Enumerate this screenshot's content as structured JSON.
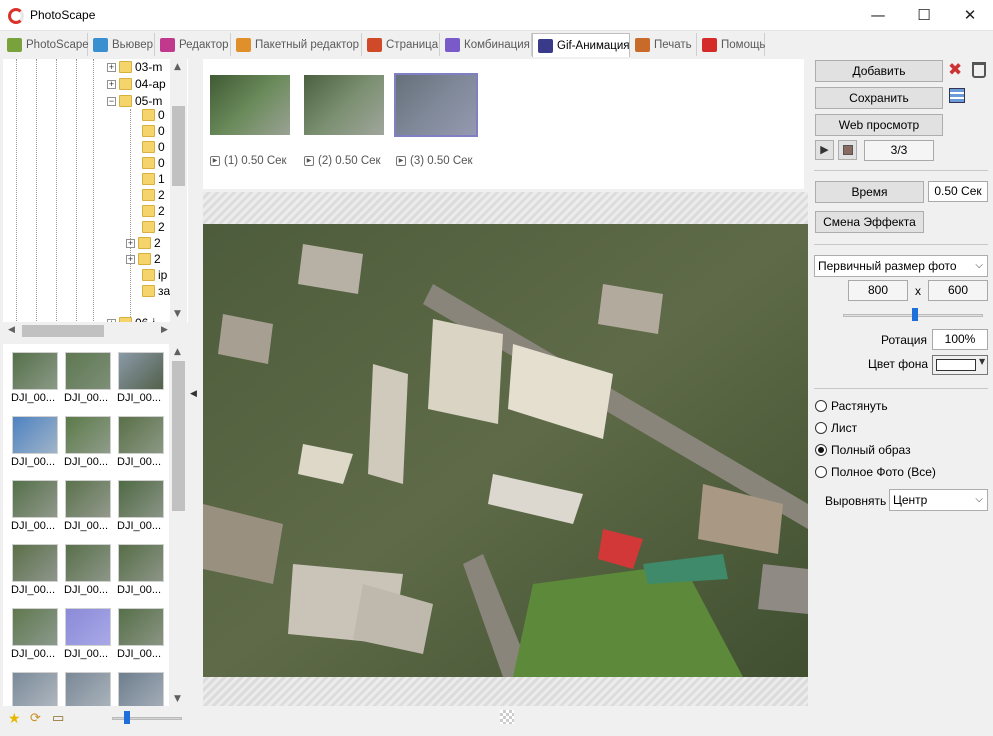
{
  "window": {
    "title": "PhotoScape",
    "minimize": "—",
    "maximize": "☐",
    "close": "✕"
  },
  "tabs": [
    {
      "label": "PhotoScape",
      "color": "#7aa23c"
    },
    {
      "label": "Вьювер",
      "color": "#3a8fd0"
    },
    {
      "label": "Редактор",
      "color": "#c0398c"
    },
    {
      "label": "Пакетный редактор",
      "color": "#e0902a"
    },
    {
      "label": "Страница",
      "color": "#d04a2a"
    },
    {
      "label": "Комбинация",
      "color": "#7a5ac8"
    },
    {
      "label": "Gif-Анимация",
      "color": "#3a3a8a"
    },
    {
      "label": "Печать",
      "color": "#c86a2a"
    },
    {
      "label": "Помощь",
      "color": "#d42a2a"
    }
  ],
  "active_tab": "Gif-Анимация",
  "tree": {
    "items": [
      {
        "label": "03-m",
        "expander": "+"
      },
      {
        "label": "04-ap",
        "expander": "+"
      },
      {
        "label": "05-m",
        "expander": "−"
      }
    ],
    "children": [
      "0",
      "0",
      "0",
      "0",
      "1",
      "2",
      "2",
      "2",
      "2",
      "2",
      "ip",
      "за"
    ],
    "last": "06-j"
  },
  "thumbnails": [
    {
      "caption": "DJI_00..."
    },
    {
      "caption": "DJI_00..."
    },
    {
      "caption": "DJI_00..."
    },
    {
      "caption": "DJI_00..."
    },
    {
      "caption": "DJI_00..."
    },
    {
      "caption": "DJI_00..."
    },
    {
      "caption": "DJI_00..."
    },
    {
      "caption": "DJI_00..."
    },
    {
      "caption": "DJI_00..."
    },
    {
      "caption": "DJI_00..."
    },
    {
      "caption": "DJI_00..."
    },
    {
      "caption": "DJI_00..."
    },
    {
      "caption": "DJI_00..."
    },
    {
      "caption": "DJI_00..."
    },
    {
      "caption": "DJI_00..."
    },
    {
      "caption": ""
    },
    {
      "caption": ""
    },
    {
      "caption": ""
    }
  ],
  "frames": [
    {
      "caption": "(1) 0.50 Сек"
    },
    {
      "caption": "(2) 0.50 Сек"
    },
    {
      "caption": "(3) 0.50 Сек"
    }
  ],
  "right": {
    "add_label": "Добавить",
    "save_label": "Сохранить",
    "web_preview_label": "Web просмотр",
    "counter": "3/3",
    "time_label": "Время",
    "time_value": "0.50 Сек",
    "effect_label": "Смена Эффекта",
    "size_select": "Первичный размер фото",
    "width": "800",
    "x": "x",
    "height": "600",
    "rotation_label": "Ротация",
    "rotation_value": "100%",
    "bg_label": "Цвет фона",
    "radios": [
      {
        "label": "Растянуть",
        "checked": false
      },
      {
        "label": "Лист",
        "checked": false
      },
      {
        "label": "Полный образ",
        "checked": true
      },
      {
        "label": "Полное Фото (Все)",
        "checked": false
      }
    ],
    "align_label": "Выровнять",
    "align_value": "Центр"
  },
  "colors": {
    "accent": "#1e6fd9",
    "selected_frame": "#7f7fc4",
    "delete_icon": "#cc3333"
  }
}
